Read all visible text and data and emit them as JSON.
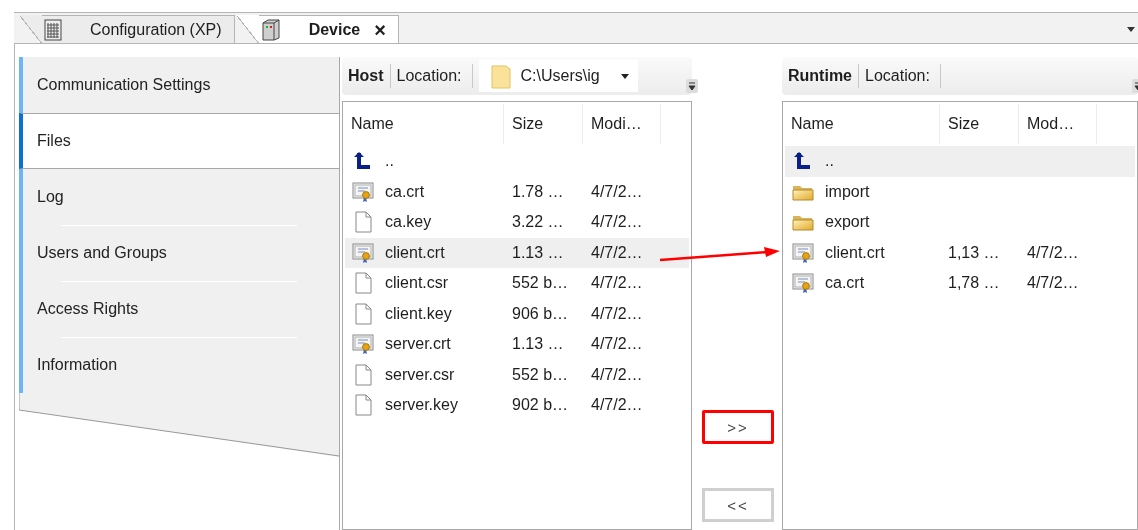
{
  "tabs": [
    {
      "label": "Configuration (XP)",
      "kind": "grid",
      "selected": false,
      "closable": false
    },
    {
      "label": "Device",
      "kind": "device",
      "selected": true,
      "closable": true
    }
  ],
  "close_glyph": "×",
  "sidebar": {
    "items": [
      {
        "label": "Communication Settings",
        "selected": false
      },
      {
        "label": "Files",
        "selected": true
      },
      {
        "label": "Log",
        "selected": false
      },
      {
        "label": "Users and Groups",
        "selected": false
      },
      {
        "label": "Access Rights",
        "selected": false
      },
      {
        "label": "Information",
        "selected": false
      }
    ]
  },
  "host": {
    "title": "Host",
    "location_label": "Location:",
    "location": "C:\\Users\\ig",
    "columns": [
      "Name",
      "Size",
      "Modi…"
    ],
    "rows": [
      {
        "kind": "up",
        "name": "..",
        "size": "",
        "modified": "",
        "selected": false
      },
      {
        "kind": "certificate",
        "name": "ca.crt",
        "size": "1.78 …",
        "modified": "4/7/2…",
        "selected": false
      },
      {
        "kind": "file",
        "name": "ca.key",
        "size": "3.22 …",
        "modified": "4/7/2…",
        "selected": false
      },
      {
        "kind": "certificate",
        "name": "client.crt",
        "size": "1.13 …",
        "modified": "4/7/2…",
        "selected": true
      },
      {
        "kind": "file",
        "name": "client.csr",
        "size": "552 b…",
        "modified": "4/7/2…",
        "selected": false
      },
      {
        "kind": "file",
        "name": "client.key",
        "size": "906 b…",
        "modified": "4/7/2…",
        "selected": false
      },
      {
        "kind": "certificate",
        "name": "server.crt",
        "size": "1.13 …",
        "modified": "4/7/2…",
        "selected": false
      },
      {
        "kind": "file",
        "name": "server.csr",
        "size": "552 b…",
        "modified": "4/7/2…",
        "selected": false
      },
      {
        "kind": "file",
        "name": "server.key",
        "size": "902 b…",
        "modified": "4/7/2…",
        "selected": false
      }
    ]
  },
  "transfer_buttons": [
    {
      "label": ">>",
      "highlighted": true
    },
    {
      "label": "<<",
      "highlighted": false
    }
  ],
  "runtime": {
    "title": "Runtime",
    "location_label": "Location:",
    "columns": [
      "Name",
      "Size",
      "Mod…"
    ],
    "rows": [
      {
        "kind": "up",
        "name": "..",
        "size": "",
        "modified": "",
        "selected": true
      },
      {
        "kind": "folder",
        "name": "import",
        "size": "",
        "modified": "",
        "selected": false
      },
      {
        "kind": "folder",
        "name": "export",
        "size": "",
        "modified": "",
        "selected": false
      },
      {
        "kind": "certificate",
        "name": "client.crt",
        "size": "1,13 …",
        "modified": "4/7/2…",
        "selected": false
      },
      {
        "kind": "certificate",
        "name": "ca.crt",
        "size": "1,78 …",
        "modified": "4/7/2…",
        "selected": false
      }
    ]
  },
  "annotations": [
    {
      "kind": "arrow"
    }
  ]
}
